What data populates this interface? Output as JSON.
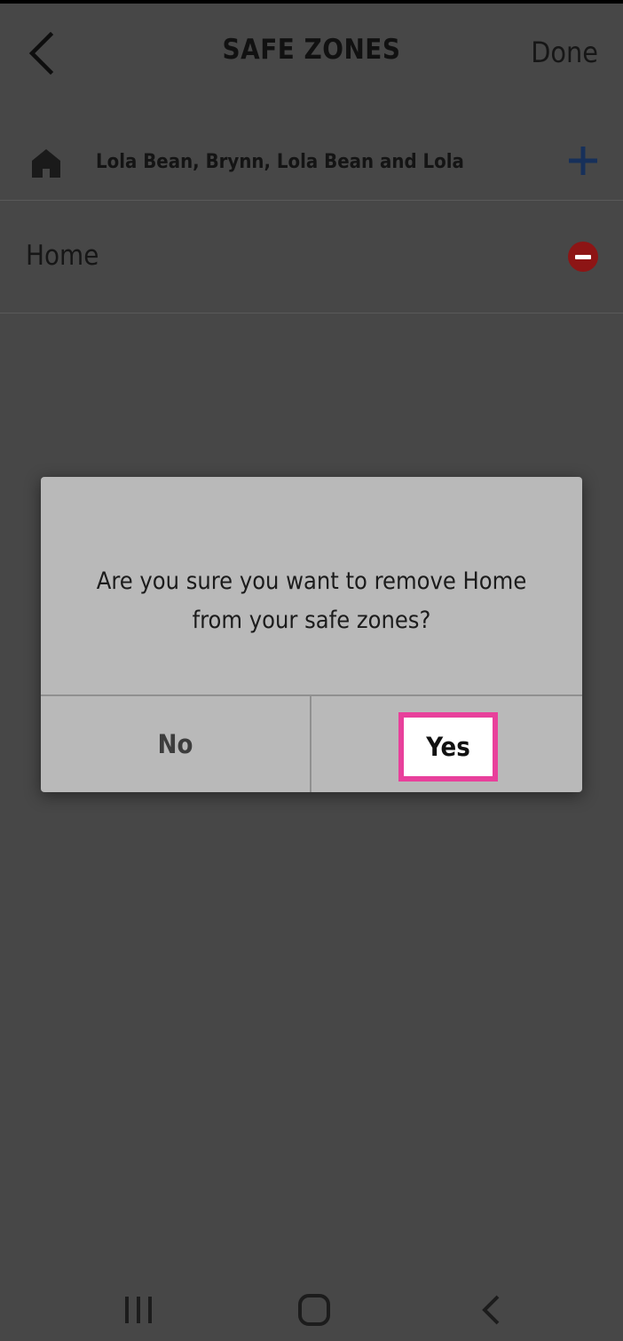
{
  "header": {
    "title": "SAFE ZONES",
    "done_label": "Done"
  },
  "family": {
    "members": "Lola Bean, Brynn, Lola Bean and Lola"
  },
  "zones": [
    {
      "label": "Home"
    }
  ],
  "dialog": {
    "message_line1": "Are you sure you want to remove Home",
    "message_line2": "from your safe zones?",
    "no_label": "No",
    "yes_label": "Yes"
  },
  "colors": {
    "background": "#474747",
    "dialog": "#b9b9b9",
    "add_accent": "#17305a",
    "remove_accent": "#8d1515",
    "highlight": "#e8409b"
  },
  "icons": {
    "back": "chevron-left-icon",
    "home": "house-icon",
    "add": "plus-icon",
    "remove": "minus-circle-icon",
    "nav_recent": "recent-apps-icon",
    "nav_home": "home-button-icon",
    "nav_back": "back-arrow-icon"
  }
}
